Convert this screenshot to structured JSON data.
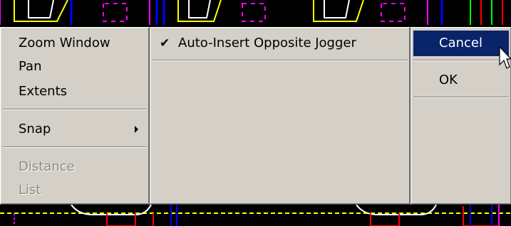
{
  "background": {
    "description_color": "#000000"
  },
  "left_menu": {
    "items": [
      {
        "label": "Zoom Window",
        "enabled": true
      },
      {
        "label": "Pan",
        "enabled": true
      },
      {
        "label": "Extents",
        "enabled": true
      },
      {
        "label": "Snap",
        "enabled": true,
        "submenu": true
      },
      {
        "label": "Distance",
        "enabled": false
      },
      {
        "label": "List",
        "enabled": false
      }
    ]
  },
  "middle_menu": {
    "items": [
      {
        "label": "Auto-Insert Opposite Jogger",
        "checked": true,
        "check_glyph": "✔"
      }
    ]
  },
  "right_menu": {
    "items": [
      {
        "label": "Cancel",
        "highlighted": true
      },
      {
        "label": "OK"
      }
    ]
  },
  "colors": {
    "menu_bg": "#d4d0c8",
    "highlight_bg": "#0a246a",
    "highlight_text": "#ffffff",
    "disabled_text": "#8e8b85"
  }
}
